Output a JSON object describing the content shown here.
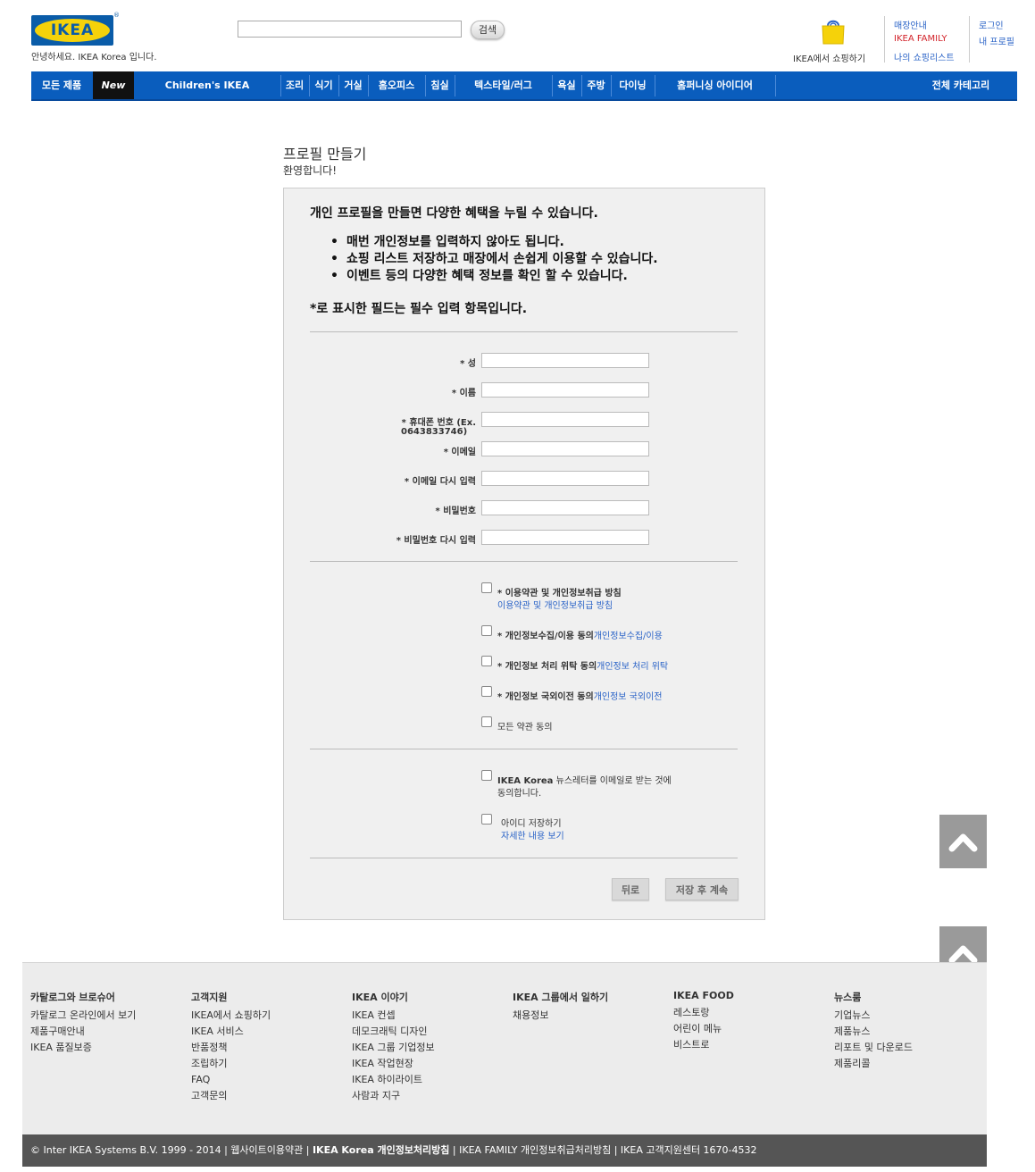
{
  "header": {
    "logo_text": "IKEA",
    "logo_reg": "®",
    "welcome": "안녕하세요. IKEA Korea 입니다.",
    "search_button": "검색",
    "shop_label": "IKEA에서 쇼핑하기",
    "links_col1": [
      "매장안내",
      "IKEA FAMILY",
      "나의 쇼핑리스트"
    ],
    "links_col2": [
      "로그인",
      "내 프로필"
    ],
    "colors": {
      "brand_blue": "#0a5ca8",
      "brand_yellow": "#f5d20a",
      "family_red": "#d2232a",
      "link_blue": "#2a63c7"
    }
  },
  "nav": {
    "items": [
      "모든 제품",
      "New",
      "Children's IKEA",
      "조리",
      "식기",
      "거실",
      "홈오피스",
      "침실",
      "텍스타일/러그",
      "욕실",
      "주방",
      "다이닝",
      "홈퍼니싱 아이디어",
      "전체 카테고리"
    ]
  },
  "page": {
    "title": "프로필 만들기",
    "subtitle": "환영합니다!"
  },
  "form": {
    "intro": "개인 프로필을 만들면 다양한 혜택을 누릴 수 있습니다.",
    "benefits": [
      "매번 개인정보를 입력하지 않아도 됩니다.",
      "쇼핑 리스트 저장하고 매장에서 손쉽게 이용할 수 있습니다.",
      "이벤트 등의 다양한 혜택 정보를 확인 할 수 있습니다."
    ],
    "required_note": "*로 표시한 필드는 필수 입력 항목입니다.",
    "fields": {
      "last_name": "* 성",
      "first_name": "* 이름",
      "phone_line1": "* 휴대폰 번호 (Ex.",
      "phone_line2": "0643833746)",
      "email": "* 이메일",
      "email_confirm": "* 이메일 다시 입력",
      "password": "* 비밀번호",
      "password_confirm": "* 비밀번호 다시 입력"
    },
    "agreements": {
      "terms_label": "* 이용약관 및 개인정보취급 방침",
      "terms_link": "이용약관 및 개인정보취급 방침",
      "collect_label": "* 개인정보수집/이용 동의",
      "collect_link": "개인정보수집/이용",
      "outsource_label": "* 개인정보 처리 위탁 동의",
      "outsource_link": "개인정보 처리 위탁",
      "transfer_label": "* 개인정보 국외이전 동의",
      "transfer_link": "개인정보 국외이전",
      "all_label": "모든 약관 동의"
    },
    "newsletter_line1": "IKEA Korea 뉴스레터를 이메일로 받는 것에",
    "newsletter_line2": "동의합니다.",
    "newsletter_brand": "IKEA Korea",
    "newsletter_rest": " 뉴스레터를 이메일로 받는 것에",
    "save_id_label": "아이디 저장하기",
    "save_id_link": "자세한 내용 보기",
    "back_button": "뒤로",
    "save_button": "저장 후 계속"
  },
  "footer": {
    "columns": [
      {
        "title": "카탈로그와 브로슈어",
        "items": [
          "카탈로그 온라인에서 보기",
          "제품구매안내",
          "IKEA 품질보증"
        ]
      },
      {
        "title": "고객지원",
        "items": [
          "IKEA에서 쇼핑하기",
          "IKEA 서비스",
          "반품정책",
          "조립하기",
          "FAQ",
          "고객문의"
        ]
      },
      {
        "title": "IKEA 이야기",
        "items": [
          "IKEA 컨셉",
          "데모크래틱 디자인",
          "IKEA 그룹 기업정보",
          "IKEA 작업현장",
          "IKEA 하이라이트",
          "사람과 지구"
        ]
      },
      {
        "title": "IKEA 그룹에서 일하기",
        "items": [
          "채용정보"
        ]
      },
      {
        "title": "IKEA FOOD",
        "items": [
          "레스토랑",
          "어린이 메뉴",
          "비스트로"
        ]
      },
      {
        "title": "뉴스룸",
        "items": [
          "기업뉴스",
          "제품뉴스",
          "리포트 및 다운로드",
          "제품리콜"
        ]
      }
    ],
    "copyright": {
      "part1": "© Inter IKEA Systems B.V. 1999 - 2014 | 웹사이트이용약관 | ",
      "part2": "IKEA Korea 개인정보처리방침",
      "part3": " | IKEA FAMILY 개인정보취급처리방침 | IKEA 고객지원센터 1670-4532"
    }
  }
}
